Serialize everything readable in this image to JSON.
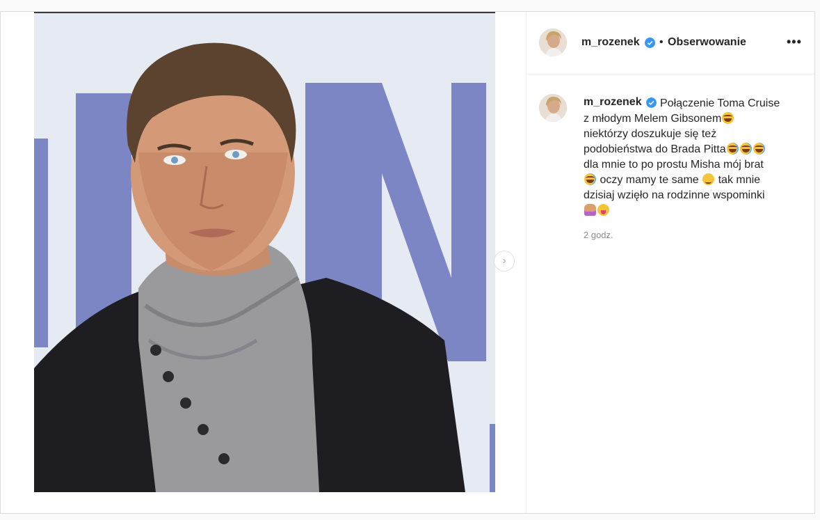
{
  "post": {
    "author": "m_rozenek",
    "follow_state": "Obserwowanie",
    "separator": "•",
    "more_label": "•••",
    "next_arrow": "›",
    "caption_lines": [
      "Połączenie Toma Cruise",
      "z młodym Melem Gibsonem",
      "niektórzy doszukuje się też",
      "podobieństwa do Brada Pitta",
      "dla mnie to po prostu Misha mój brat",
      " oczy mamy te same ",
      " tak mnie",
      "dzisiaj wzięło na rodzinne wspominki"
    ],
    "timestamp": "2 godz."
  },
  "icons": {
    "verified": "verified-badge-icon",
    "more": "more-options-icon",
    "next": "chevron-right-icon"
  },
  "colors": {
    "verified": "#3897f0",
    "text": "#262626",
    "muted": "#8e8e8e",
    "border": "#dbdbdb"
  }
}
